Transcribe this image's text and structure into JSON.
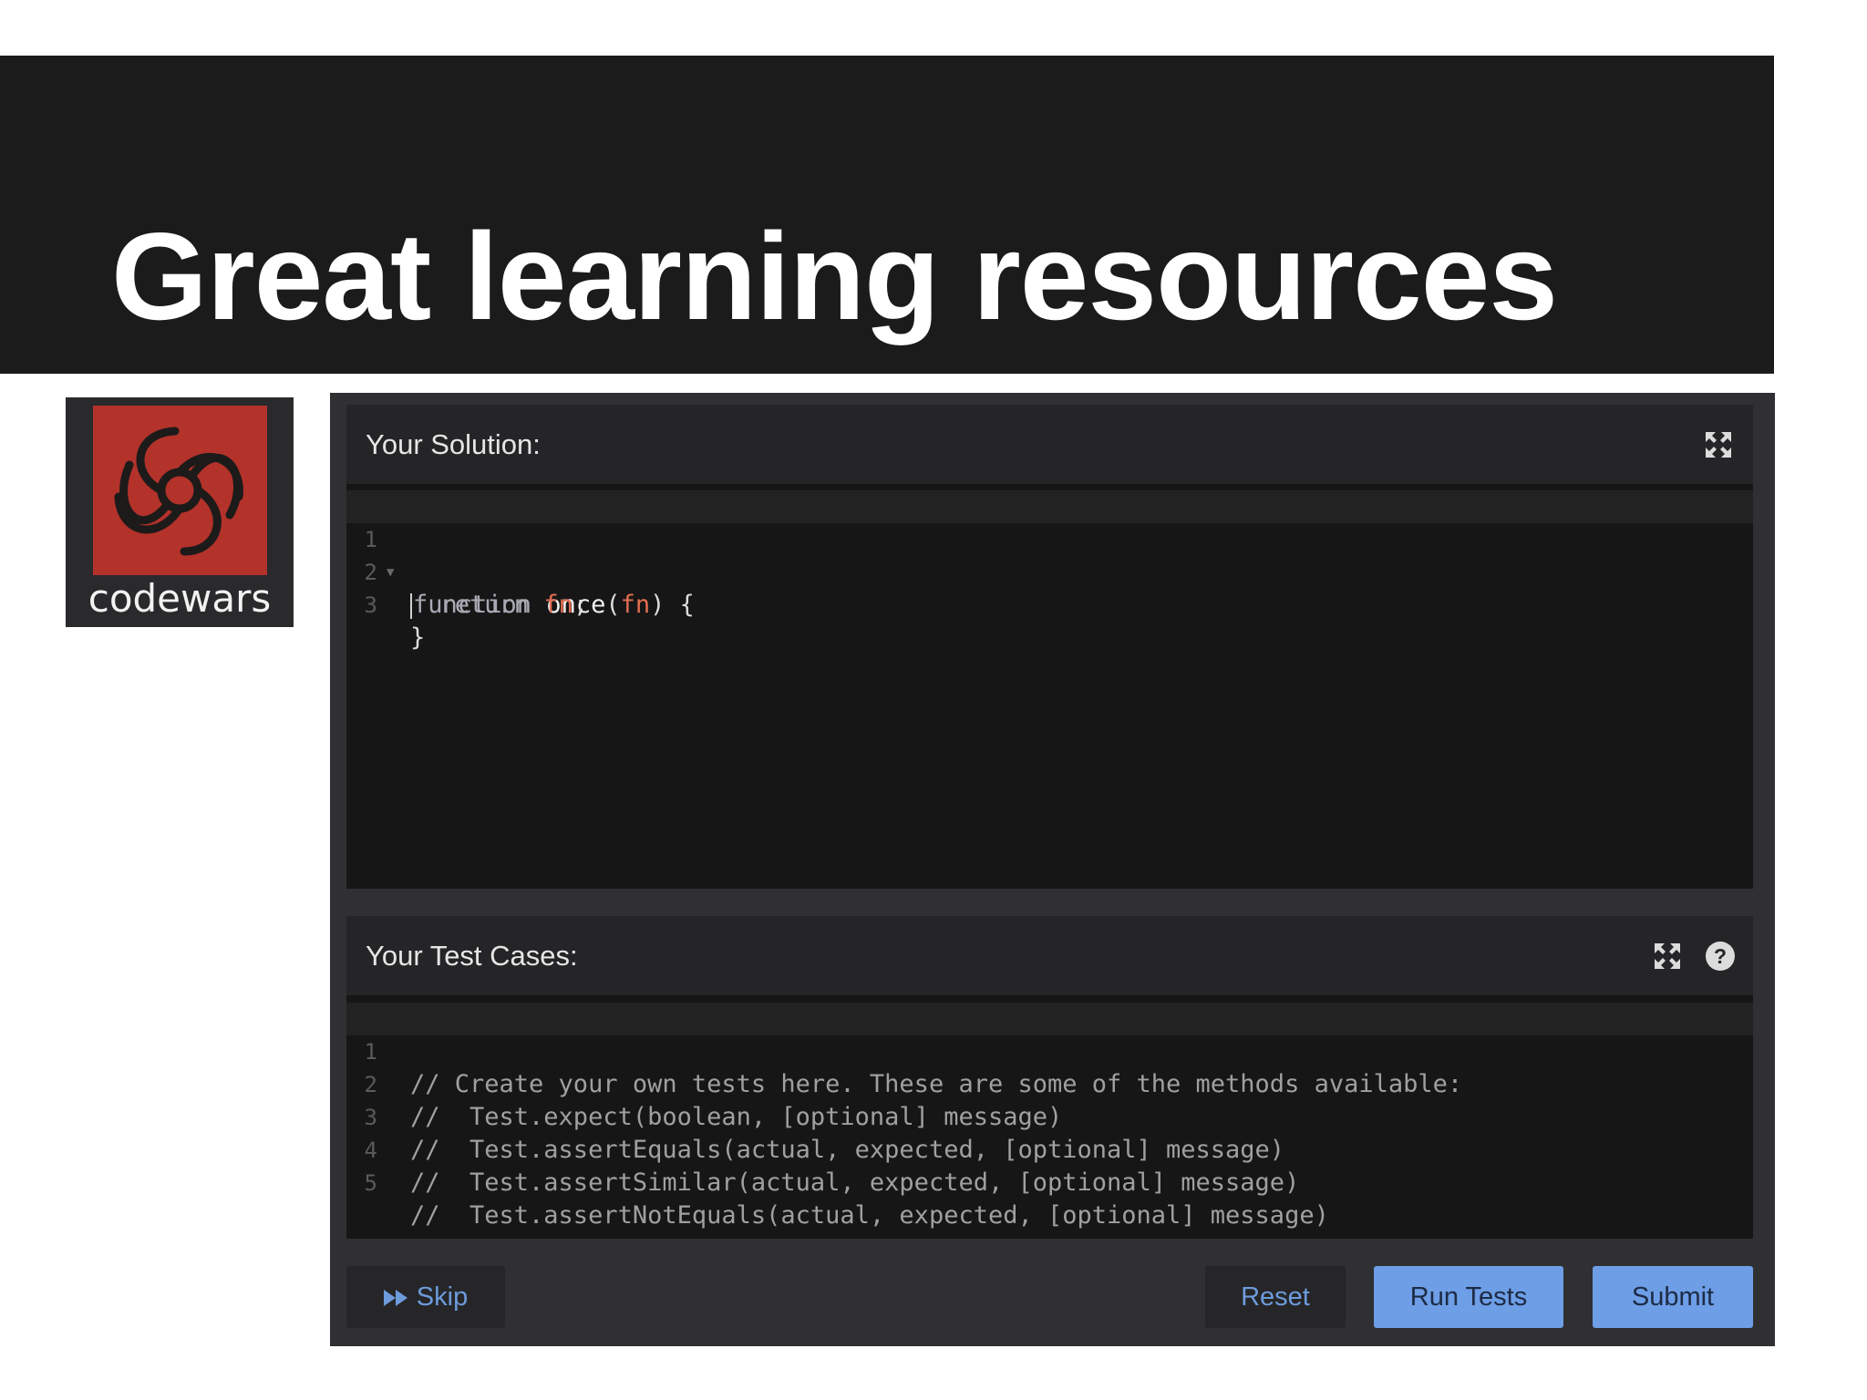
{
  "slide": {
    "title": "Great learning resources"
  },
  "logo": {
    "text": "codewars",
    "tile_color": "#b3322a"
  },
  "solution": {
    "title": "Your Solution:",
    "fullscreen_icon": "expand-icon",
    "lines": [
      {
        "n": "1",
        "parts": [
          [
            "kw",
            "function"
          ],
          [
            "punct",
            " "
          ],
          [
            "fnname",
            "once"
          ],
          [
            "punct",
            "("
          ],
          [
            "param",
            "fn"
          ],
          [
            "punct",
            ") {"
          ]
        ]
      },
      {
        "n": "2",
        "parts": [
          [
            "punct",
            "  "
          ],
          [
            "kw",
            "return"
          ],
          [
            "punct",
            " "
          ],
          [
            "param",
            "fn"
          ],
          [
            "punct",
            ";"
          ]
        ]
      },
      {
        "n": "3",
        "parts": [
          [
            "punct",
            "}"
          ]
        ]
      }
    ]
  },
  "tests": {
    "title": "Your Test Cases:",
    "fullscreen_icon": "expand-icon",
    "help_icon": "question-icon",
    "lines": [
      {
        "n": "1",
        "text": "// Create your own tests here. These are some of the methods available:"
      },
      {
        "n": "2",
        "text": "//  Test.expect(boolean, [optional] message)"
      },
      {
        "n": "3",
        "text": "//  Test.assertEquals(actual, expected, [optional] message)"
      },
      {
        "n": "4",
        "text": "//  Test.assertSimilar(actual, expected, [optional] message)"
      },
      {
        "n": "5",
        "text": "//  Test.assertNotEquals(actual, expected, [optional] message)"
      }
    ]
  },
  "actions": {
    "skip": "Skip",
    "skip_icon": "fast-forward-icon",
    "reset": "Reset",
    "run_tests": "Run Tests",
    "submit": "Submit"
  },
  "colors": {
    "accent_blue": "#6d9ee6",
    "param_red": "#e36e52"
  }
}
